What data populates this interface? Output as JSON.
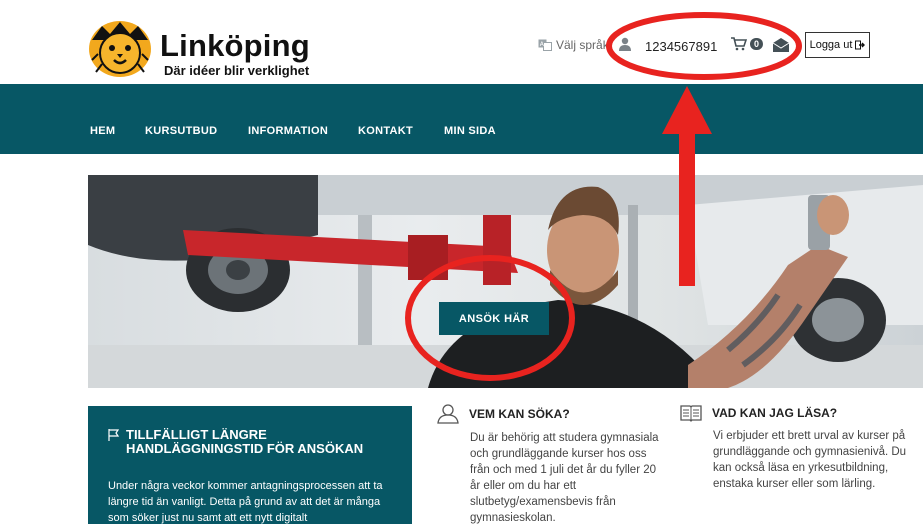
{
  "header": {
    "logo_title": "Linköping",
    "logo_subtitle": "Där idéer blir verklighet",
    "language_label": "Välj språk",
    "user_id": "1234567891",
    "cart_count": "0",
    "logout_label": "Logga ut"
  },
  "nav": {
    "items": [
      {
        "label": "HEM"
      },
      {
        "label": "KURSUTBUD"
      },
      {
        "label": "INFORMATION"
      },
      {
        "label": "KONTAKT"
      },
      {
        "label": "MIN SIDA"
      }
    ]
  },
  "hero": {
    "apply_label": "ANSÖK HÄR"
  },
  "notice": {
    "title": "TILLFÄLLIGT LÄNGRE HANDLÄGGNINGSTID FÖR ANSÖKAN",
    "body": "Under några veckor kommer antagningsprocessen att ta längre tid än vanligt. Detta på grund av att det är många som söker just nu samt att ett nytt digitalt"
  },
  "who": {
    "title": "VEM KAN SÖKA?",
    "body": "Du är behörig att studera gymnasiala och grundläggande kurser hos oss från och med 1 juli det år du fyller 20 år eller om du har ett slutbetyg/examensbevis från gymnasieskolan."
  },
  "what": {
    "title": "VAD KAN JAG LÄSA?",
    "body": "Vi erbjuder ett brett urval av kurser på grundläggande och gymnasienivå. Du kan också läsa en yrkesutbildning, enstaka kurser eller som lärling."
  },
  "colors": {
    "brand_teal": "#075765",
    "annotation_red": "#e8231f"
  },
  "icons": [
    "lion-logo-icon",
    "translate-icon",
    "user-icon",
    "cart-icon",
    "mail-icon",
    "logout-icon",
    "flag-icon",
    "person-outline-icon",
    "book-icon"
  ]
}
